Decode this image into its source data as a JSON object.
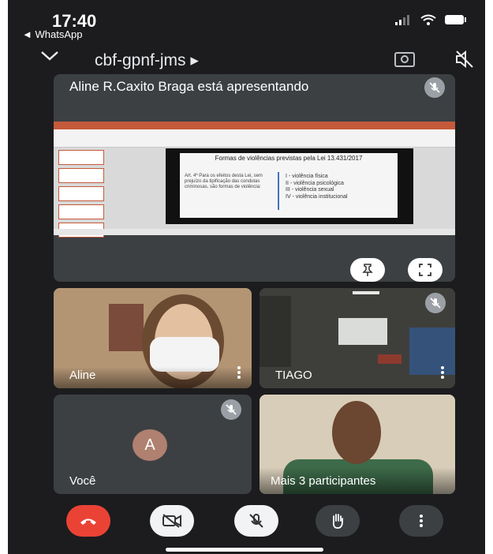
{
  "status_bar": {
    "time": "17:40",
    "back_label": "◄ WhatsApp"
  },
  "header": {
    "meeting_code": "cbf-gpnf-jms ▸"
  },
  "presentation": {
    "label": "Aline R.Caxito Braga está apresentando",
    "slide": {
      "title": "Formas de violências previstas pela Lei 13.431/2017",
      "left_text": "Art. 4º Para os efeitos desta Lei, sem prejuízo da tipificação das condutas criminosas, são formas de violência:",
      "items": [
        "I - violência física",
        "II - violência psicológica",
        "III - violência sexual",
        "IV - violência institucional"
      ]
    }
  },
  "participants": [
    {
      "name": "Aline"
    },
    {
      "name": "TIAGO"
    },
    {
      "name": "Você",
      "avatar_letter": "A"
    },
    {
      "name": "Mais 3 participantes"
    }
  ],
  "colors": {
    "background": "#1c1c1e",
    "tile": "#3c4043",
    "end_call": "#ea4335",
    "avatar": "#b08070"
  },
  "icons": [
    "chevron-down-icon",
    "camera-flip-icon",
    "speaker-off-icon",
    "mic-off-icon",
    "pin-icon",
    "fullscreen-icon",
    "more-vert-icon",
    "end-call-icon",
    "video-off-icon",
    "raise-hand-icon"
  ]
}
